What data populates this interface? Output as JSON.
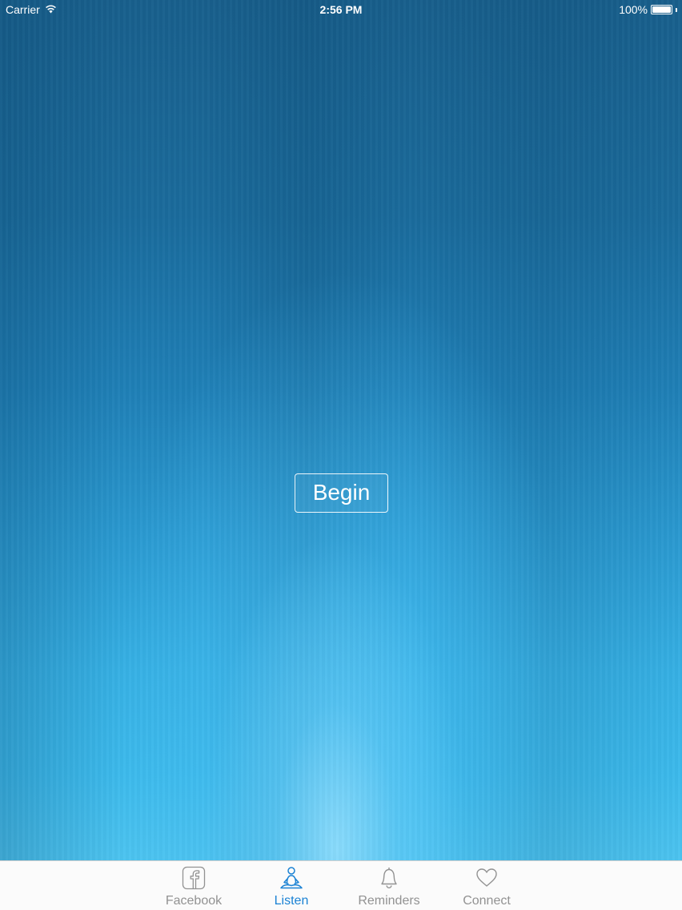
{
  "status_bar": {
    "carrier": "Carrier",
    "wifi_icon": "wifi-icon",
    "time": "2:56 PM",
    "battery_percent": "100%",
    "battery_level": 1.0
  },
  "main": {
    "begin_label": "Begin"
  },
  "tab_bar": {
    "items": [
      {
        "label": "Facebook",
        "icon": "facebook-icon",
        "active": false
      },
      {
        "label": "Listen",
        "icon": "meditating-person-icon",
        "active": true
      },
      {
        "label": "Reminders",
        "icon": "bell-icon",
        "active": false
      },
      {
        "label": "Connect",
        "icon": "heart-icon",
        "active": false
      }
    ],
    "active_color": "#1a82d4",
    "inactive_color": "#929292"
  }
}
